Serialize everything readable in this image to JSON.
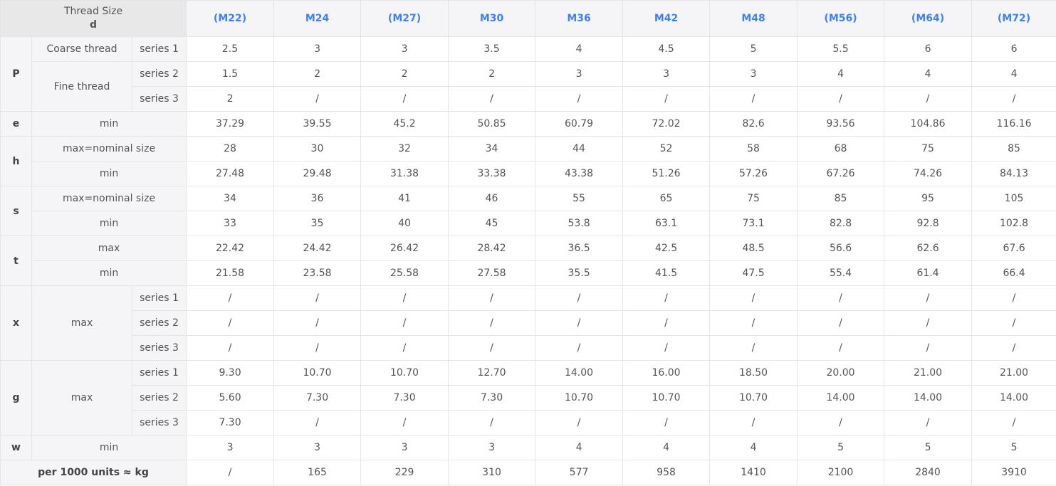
{
  "header": {
    "corner_line1": "Thread Size",
    "corner_line2": "d",
    "sizes": [
      "(M22)",
      "M24",
      "(M27)",
      "M30",
      "M36",
      "M42",
      "M48",
      "(M56)",
      "(M64)",
      "(M72)"
    ]
  },
  "rows": {
    "P": {
      "symbol": "P",
      "coarse_label": "Coarse thread",
      "fine_label": "Fine thread",
      "series1": "series 1",
      "series2": "series 2",
      "series3": "series 3",
      "coarse_values": [
        "2.5",
        "3",
        "3",
        "3.5",
        "4",
        "4.5",
        "5",
        "5.5",
        "6",
        "6"
      ],
      "fine2_values": [
        "1.5",
        "2",
        "2",
        "2",
        "3",
        "3",
        "3",
        "4",
        "4",
        "4"
      ],
      "fine3_values": [
        "2",
        "/",
        "/",
        "/",
        "/",
        "/",
        "/",
        "/",
        "/",
        "/"
      ]
    },
    "e": {
      "symbol": "e",
      "min_label": "min",
      "min_values": [
        "37.29",
        "39.55",
        "45.2",
        "50.85",
        "60.79",
        "72.02",
        "82.6",
        "93.56",
        "104.86",
        "116.16"
      ]
    },
    "h": {
      "symbol": "h",
      "max_label": "max=nominal size",
      "min_label": "min",
      "max_values": [
        "28",
        "30",
        "32",
        "34",
        "44",
        "52",
        "58",
        "68",
        "75",
        "85"
      ],
      "min_values": [
        "27.48",
        "29.48",
        "31.38",
        "33.38",
        "43.38",
        "51.26",
        "57.26",
        "67.26",
        "74.26",
        "84.13"
      ]
    },
    "s": {
      "symbol": "s",
      "max_label": "max=nominal size",
      "min_label": "min",
      "max_values": [
        "34",
        "36",
        "41",
        "46",
        "55",
        "65",
        "75",
        "85",
        "95",
        "105"
      ],
      "min_values": [
        "33",
        "35",
        "40",
        "45",
        "53.8",
        "63.1",
        "73.1",
        "82.8",
        "92.8",
        "102.8"
      ]
    },
    "t": {
      "symbol": "t",
      "max_label": "max",
      "min_label": "min",
      "max_values": [
        "22.42",
        "24.42",
        "26.42",
        "28.42",
        "36.5",
        "42.5",
        "48.5",
        "56.6",
        "62.6",
        "67.6"
      ],
      "min_values": [
        "21.58",
        "23.58",
        "25.58",
        "27.58",
        "35.5",
        "41.5",
        "47.5",
        "55.4",
        "61.4",
        "66.4"
      ]
    },
    "x": {
      "symbol": "x",
      "max_label": "max",
      "series1": "series 1",
      "series2": "series 2",
      "series3": "series 3",
      "s1_values": [
        "/",
        "/",
        "/",
        "/",
        "/",
        "/",
        "/",
        "/",
        "/",
        "/"
      ],
      "s2_values": [
        "/",
        "/",
        "/",
        "/",
        "/",
        "/",
        "/",
        "/",
        "/",
        "/"
      ],
      "s3_values": [
        "/",
        "/",
        "/",
        "/",
        "/",
        "/",
        "/",
        "/",
        "/",
        "/"
      ]
    },
    "g": {
      "symbol": "g",
      "max_label": "max",
      "series1": "series 1",
      "series2": "series 2",
      "series3": "series 3",
      "s1_values": [
        "9.30",
        "10.70",
        "10.70",
        "12.70",
        "14.00",
        "16.00",
        "18.50",
        "20.00",
        "21.00",
        "21.00"
      ],
      "s2_values": [
        "5.60",
        "7.30",
        "7.30",
        "7.30",
        "10.70",
        "10.70",
        "10.70",
        "14.00",
        "14.00",
        "14.00"
      ],
      "s3_values": [
        "7.30",
        "/",
        "/",
        "/",
        "/",
        "/",
        "/",
        "/",
        "/",
        "/"
      ]
    },
    "w": {
      "symbol": "w",
      "min_label": "min",
      "min_values": [
        "3",
        "3",
        "3",
        "3",
        "4",
        "4",
        "4",
        "5",
        "5",
        "5"
      ]
    },
    "weight": {
      "label": "per 1000 units ≈ kg",
      "values": [
        "/",
        "165",
        "229",
        "310",
        "577",
        "958",
        "1410",
        "2100",
        "2840",
        "3910"
      ]
    }
  }
}
